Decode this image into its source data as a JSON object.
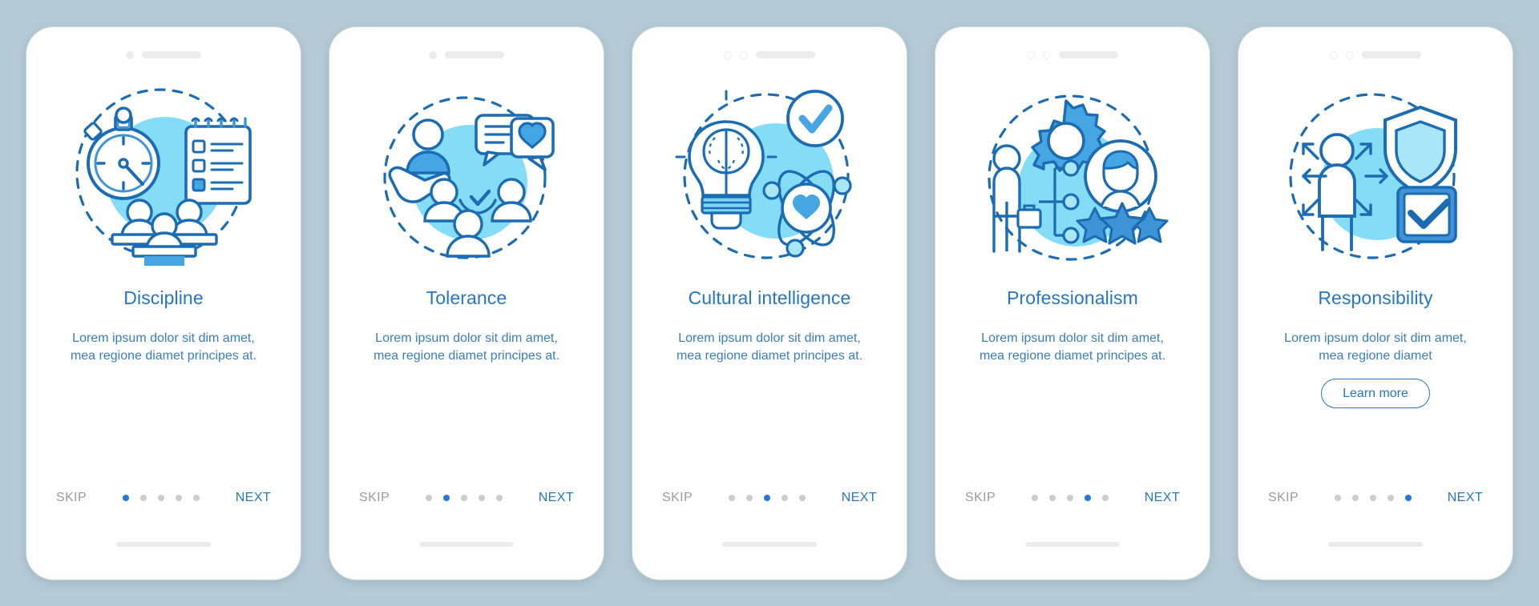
{
  "background_color": "#b6cbd6",
  "theme": {
    "title_color": "#2577c4",
    "body_color": "#3a7ebf",
    "skip_color": "#9a9a9a",
    "next_color": "#2577c4",
    "dot_active_color": "#1f7ad4",
    "dot_inactive_color": "#c9cdd1",
    "blob_color": "#84dcf7",
    "accent_color": "#1b6cb3"
  },
  "nav_labels": {
    "skip": "SKIP",
    "next": "NEXT"
  },
  "total_screens": 5,
  "screens": [
    {
      "index": 1,
      "illustration": "stopwatch-checklist-team-icon",
      "notch_style": "single-filled-dot",
      "title": "Discipline",
      "body": "Lorem ipsum dolor sit dim amet, mea regione diamet principes at.",
      "skip": "SKIP",
      "next": "NEXT",
      "active_dot": 1,
      "has_learn_more": false,
      "learn_more_label": ""
    },
    {
      "index": 2,
      "illustration": "hand-people-chat-heart-icon",
      "notch_style": "single-filled-dot",
      "title": "Tolerance",
      "body": "Lorem ipsum dolor sit dim amet, mea regione diamet principes at.",
      "skip": "SKIP",
      "next": "NEXT",
      "active_dot": 2,
      "has_learn_more": false,
      "learn_more_label": ""
    },
    {
      "index": 3,
      "illustration": "brain-bulb-atom-check-icon",
      "notch_style": "double-outline-dot",
      "title": "Cultural intelligence",
      "body": "Lorem ipsum dolor sit dim amet, mea regione diamet principes at.",
      "skip": "SKIP",
      "next": "NEXT",
      "active_dot": 3,
      "has_learn_more": false,
      "learn_more_label": ""
    },
    {
      "index": 4,
      "illustration": "businessman-gear-stars-avatar-icon",
      "notch_style": "double-outline-dot",
      "title": "Professionalism",
      "body": "Lorem ipsum dolor sit dim amet, mea regione diamet principes at.",
      "skip": "SKIP",
      "next": "NEXT",
      "active_dot": 4,
      "has_learn_more": false,
      "learn_more_label": ""
    },
    {
      "index": 5,
      "illustration": "person-shield-checkbox-arrows-icon",
      "notch_style": "double-outline-dot",
      "title": "Responsibility",
      "body": "Lorem ipsum dolor sit dim amet, mea regione diamet",
      "skip": "SKIP",
      "next": "NEXT",
      "active_dot": 5,
      "has_learn_more": true,
      "learn_more_label": "Learn more"
    }
  ]
}
